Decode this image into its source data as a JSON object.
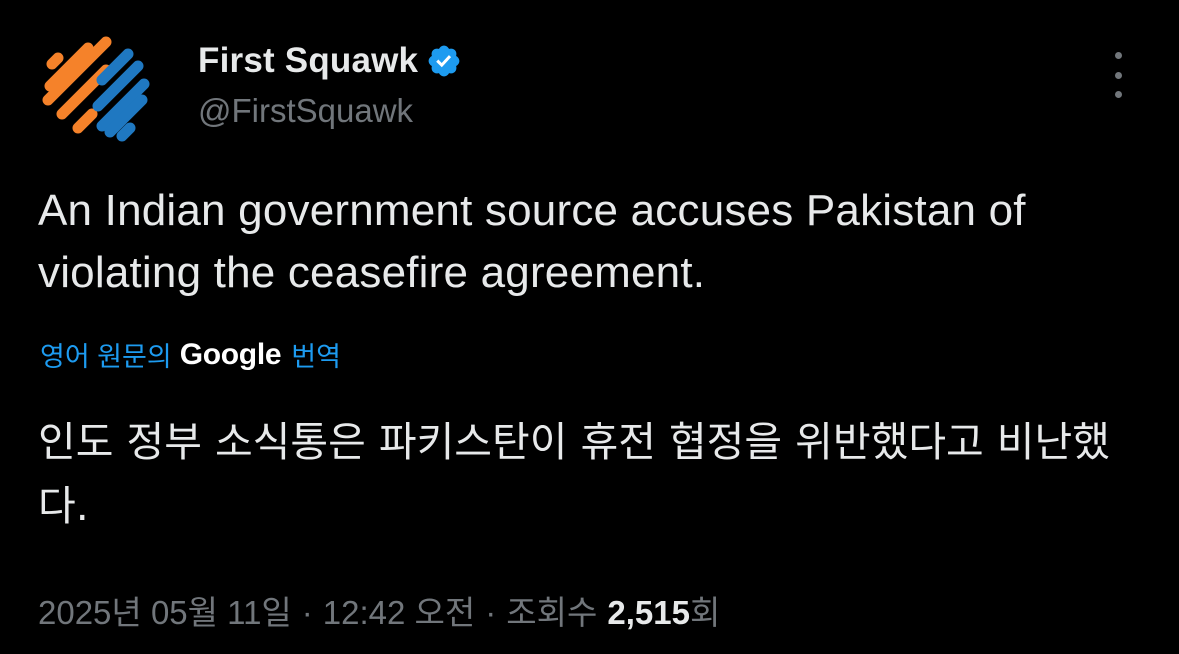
{
  "author": {
    "display_name": "First Squawk",
    "handle": "@FirstSquawk",
    "verified": true,
    "avatar_icon": "first-squawk-logo",
    "verified_icon": "verified-badge-icon",
    "menu_icon": "more-vertical-icon"
  },
  "tweet": {
    "text": "An Indian government source accuses Pakistan of violating the ceasefire agreement."
  },
  "translation": {
    "prefix": "영어 원문의",
    "provider": "Google",
    "suffix": "번역",
    "text": "인도 정부 소식통은 파키스탄이 휴전 협정을 위반했다고 비난했다."
  },
  "meta": {
    "date": "2025년 05월 11일",
    "separator": "·",
    "time": "12:42 오전",
    "views_label": "조회수",
    "views_count": "2,515",
    "views_suffix": "회"
  },
  "colors": {
    "background": "#000000",
    "text_primary": "#e7e9ea",
    "text_secondary": "#71767b",
    "accent": "#1d9bf0",
    "logo_orange": "#f5822a",
    "logo_blue": "#1f78c1"
  }
}
